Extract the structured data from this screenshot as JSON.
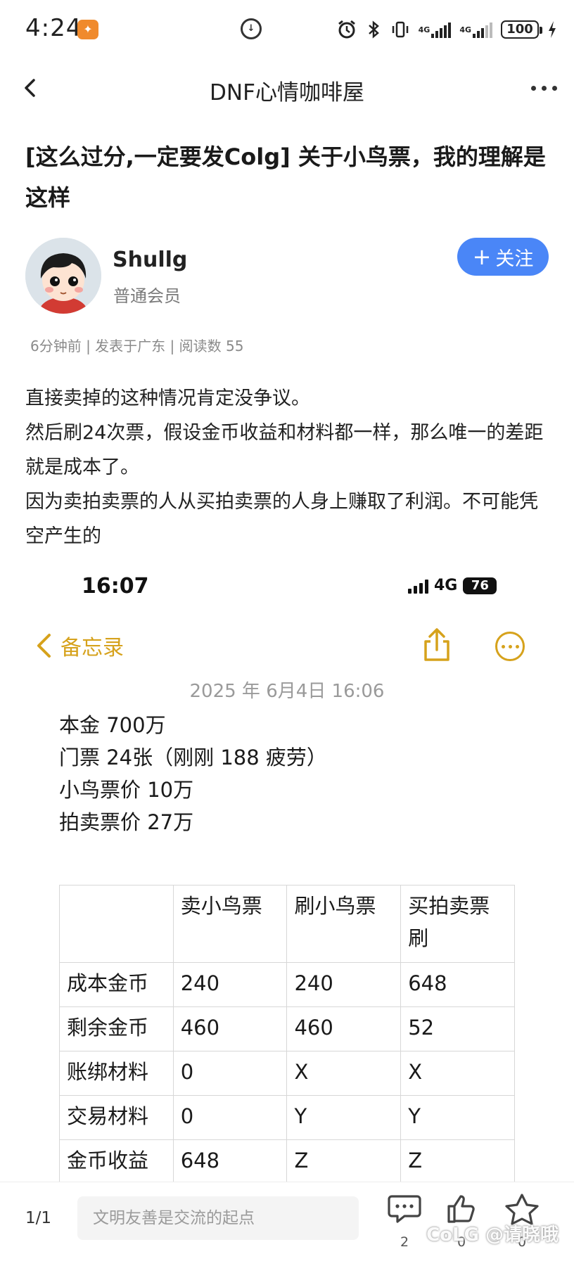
{
  "status_bar": {
    "time": "4:24",
    "battery": "100"
  },
  "nav": {
    "title": "DNF心情咖啡屋"
  },
  "post": {
    "title": "[这么过分,一定要发Colg] 关于小鸟票，我的理解是这样",
    "author": {
      "name": "Shullg",
      "role": "普通会员",
      "follow_label": "关注"
    },
    "meta": "6分钟前 | 发表于广东 | 阅读数 55",
    "body": [
      "直接卖掉的这种情况肯定没争议。",
      "然后刷24次票，假设金币收益和材料都一样，那么唯一的差距就是成本了。",
      "因为卖拍卖票的人从买拍卖票的人身上赚取了利润。不可能凭空产生的"
    ]
  },
  "embedded_screenshot": {
    "time": "16:07",
    "network": "4G",
    "battery": "76",
    "back_label": "备忘录",
    "date": "2025 年 6月4日 16:06",
    "lines": [
      "本金 700万",
      "门票 24张（刚刚 188 疲劳）",
      "小鸟票价 10万",
      "拍卖票价 27万"
    ],
    "table": {
      "headers": [
        "",
        "卖小鸟票",
        "刷小鸟票",
        "买拍卖票刷"
      ],
      "rows": [
        [
          "成本金币",
          "240",
          "240",
          "648"
        ],
        [
          "剩余金币",
          "460",
          "460",
          "52"
        ],
        [
          "账绑材料",
          "0",
          "X",
          "X"
        ],
        [
          "交易材料",
          "0",
          "Y",
          "Y"
        ],
        [
          "金币收益",
          "648",
          "Z",
          "Z"
        ]
      ]
    }
  },
  "bottom_bar": {
    "page_indicator": "1/1",
    "comment_placeholder": "文明友善是交流的起点",
    "comment_count": "2",
    "like_count": "0",
    "fav_count": "0",
    "watermark": "CoLG @请晓哦"
  },
  "colors": {
    "accent_blue": "#4a86f7",
    "notes_yellow": "#d6a21c"
  }
}
